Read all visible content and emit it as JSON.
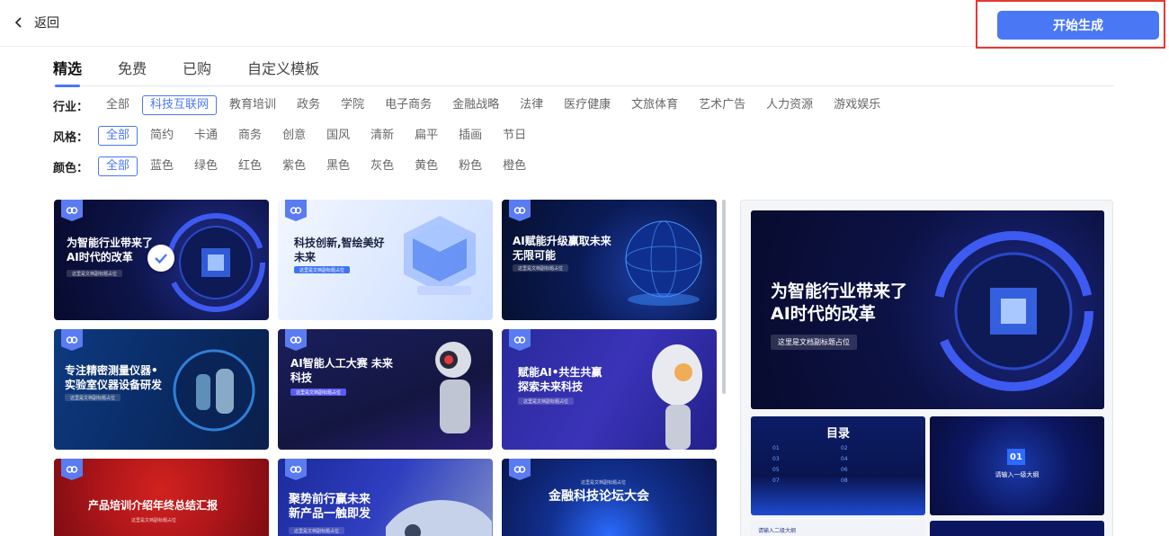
{
  "header": {
    "back_label": "返回",
    "generate_label": "开始生成"
  },
  "tabs": [
    {
      "label": "精选",
      "active": true
    },
    {
      "label": "免费",
      "active": false
    },
    {
      "label": "已购",
      "active": false
    },
    {
      "label": "自定义模板",
      "active": false
    }
  ],
  "filters": {
    "industry": {
      "label": "行业：",
      "options": [
        "全部",
        "科技互联网",
        "教育培训",
        "政务",
        "学院",
        "电子商务",
        "金融战略",
        "法律",
        "医疗健康",
        "文旅体育",
        "艺术广告",
        "人力资源",
        "游戏娱乐"
      ],
      "selected": "科技互联网"
    },
    "style": {
      "label": "风格：",
      "options": [
        "全部",
        "简约",
        "卡通",
        "商务",
        "创意",
        "国风",
        "清新",
        "扁平",
        "插画",
        "节日"
      ],
      "selected": "全部"
    },
    "color": {
      "label": "颜色：",
      "options": [
        "全部",
        "蓝色",
        "绿色",
        "红色",
        "紫色",
        "黑色",
        "灰色",
        "黄色",
        "粉色",
        "橙色"
      ],
      "selected": "全部"
    }
  },
  "templates": [
    {
      "title": "为智能行业带来了\nAI时代的改革",
      "subtitle": "这里是文档副标题占位",
      "selected": true
    },
    {
      "title": "科技创新,智绘美好\n未来",
      "subtitle": "这里是文档副标题占位",
      "selected": false
    },
    {
      "title": "AI赋能升级赢取未来\n无限可能",
      "subtitle": "这里是文档副标题占位",
      "selected": false
    },
    {
      "title": "专注精密测量仪器•\n实验室仪器设备研发",
      "subtitle": "这里是文档副标题占位",
      "selected": false
    },
    {
      "title": "AI智能人工大赛 未来\n科技",
      "subtitle": "这里是文档副标题占位",
      "selected": false
    },
    {
      "title": "赋能AI•共生共赢\n探索未来科技",
      "subtitle": "这里是文档副标题占位",
      "selected": false
    },
    {
      "title": "产品培训介绍年终总结汇报",
      "subtitle": "这里是文档副标题占位",
      "selected": false
    },
    {
      "title": "聚势前行赢未来\n新产品一触即发",
      "subtitle": "这里是文档副标题占位",
      "selected": false
    },
    {
      "title": "金融科技论坛大会",
      "subtitle": "这里是文档副标题占位",
      "selected": false
    }
  ],
  "preview": {
    "main_title": "为智能行业带来了\nAI时代的改革",
    "main_subtitle": "这里是文档副标题占位",
    "toc_title": "目录",
    "toc_numbers": [
      "01",
      "02",
      "03",
      "04",
      "05",
      "06",
      "07",
      "08"
    ],
    "section_number": "01",
    "section_title": "请输入一级大纲",
    "subsection_title": "请输入二级大纲"
  },
  "colors": {
    "accent": "#4a78f5",
    "highlight_border": "#e53935"
  }
}
